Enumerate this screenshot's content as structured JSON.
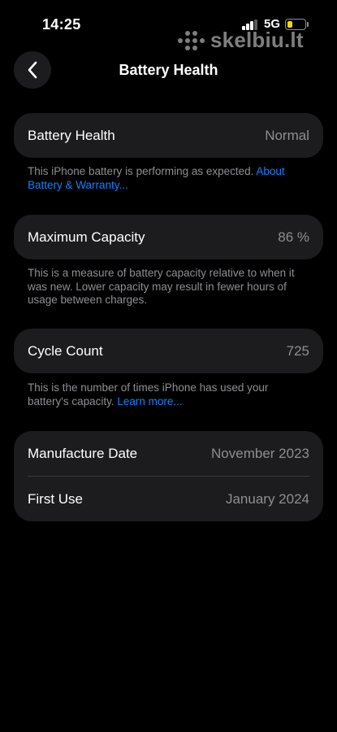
{
  "status_bar": {
    "time": "14:25",
    "network": "5G",
    "battery_level": 0.3
  },
  "watermark": {
    "text": "skelbiu.lt"
  },
  "nav": {
    "title": "Battery Health"
  },
  "battery_health": {
    "label": "Battery Health",
    "value": "Normal"
  },
  "battery_note": {
    "text": "This iPhone battery is performing as expected. ",
    "link": "About Battery & Warranty..."
  },
  "max_capacity": {
    "label": "Maximum Capacity",
    "value": "86 %"
  },
  "capacity_note": {
    "text": "This is a measure of battery capacity relative to when it was new. Lower capacity may result in fewer hours of usage between charges."
  },
  "cycle_count": {
    "label": "Cycle Count",
    "value": "725"
  },
  "cycle_note": {
    "text": "This is the number of times iPhone has used your battery's capacity. ",
    "link": "Learn more..."
  },
  "dates": {
    "manufacture": {
      "label": "Manufacture Date",
      "value": "November 2023"
    },
    "first_use": {
      "label": "First Use",
      "value": "January 2024"
    }
  },
  "colors": {
    "background": "#000000",
    "card": "#1c1c1e",
    "link": "#0a84ff",
    "secondary_text": "#8e8e93",
    "battery_fill": "#f5d90a"
  }
}
